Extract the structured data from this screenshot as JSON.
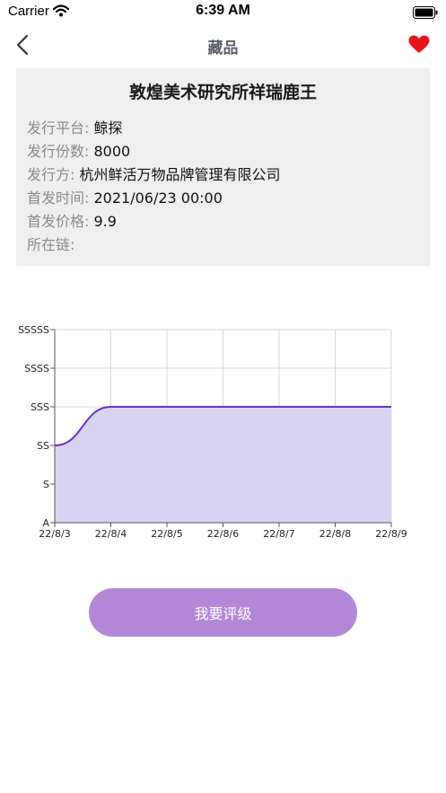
{
  "status_bar": {
    "carrier": "Carrier",
    "time": "6:39 AM"
  },
  "nav": {
    "title": "藏品"
  },
  "item": {
    "title": "敦煌美术研究所祥瑞鹿王",
    "fields": [
      {
        "label": "发行平台",
        "value": "鲸探"
      },
      {
        "label": "发行份数",
        "value": "8000"
      },
      {
        "label": "发行方",
        "value": "杭州鲜活万物品牌管理有限公司"
      },
      {
        "label": "首发时间",
        "value": "2021/06/23 00:00"
      },
      {
        "label": "首发价格",
        "value": "9.9"
      },
      {
        "label": "所在链",
        "value": ""
      }
    ]
  },
  "chart_data": {
    "type": "area",
    "x": [
      "22/8/3",
      "22/8/4",
      "22/8/5",
      "22/8/6",
      "22/8/7",
      "22/8/8",
      "22/8/9"
    ],
    "y_categories": [
      "A",
      "S",
      "SS",
      "SSS",
      "SSSS",
      "SSSSS"
    ],
    "series": [
      {
        "values": [
          "SS",
          "SSS",
          "SSS",
          "SSS",
          "SSS",
          "SSS",
          "SSS"
        ]
      }
    ],
    "grid": true,
    "colors": {
      "line": "#6a2fd6",
      "fill": "#d8d3f0",
      "grid": "#d9d9d9",
      "axis": "#555555"
    }
  },
  "action": {
    "rate_label": "我要评级"
  },
  "colors": {
    "heart": "#e8141c",
    "button": "#b388d8",
    "card": "#efefef"
  }
}
